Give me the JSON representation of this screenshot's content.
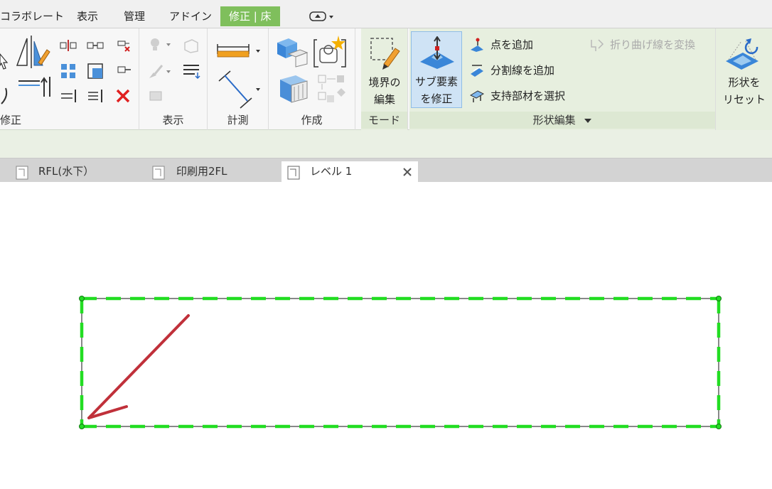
{
  "ribbon_tabs": [
    {
      "label": "コラボレート"
    },
    {
      "label": "表示"
    },
    {
      "label": "管理"
    },
    {
      "label": "アドイン"
    },
    {
      "label": "修正 | 床"
    }
  ],
  "panels": {
    "modify": {
      "label": "修正"
    },
    "view": {
      "label": "表示"
    },
    "measure": {
      "label": "計測"
    },
    "create": {
      "label": "作成"
    },
    "mode": {
      "label": "モード",
      "edit_boundary_label": "境界の\n編集"
    },
    "shape_edit": {
      "label": "形状編集",
      "modify_sub_elements_label": "サブ要素\nを修正",
      "add_point_label": "点を追加",
      "add_split_line_label": "分割線を追加",
      "pick_supports_label": "支持部材を選択",
      "draw_fold_line_label": "折り曲げ線を変換",
      "reset_shape_label": "形状を\nリセット"
    }
  },
  "view_tabs": [
    {
      "label": "RFL(水下）",
      "active": false
    },
    {
      "label": "印刷用2FL",
      "active": false
    },
    {
      "label": "レベル 1",
      "active": true
    }
  ],
  "colors": {
    "active_tab": "#7fbf5c",
    "boundary": "#22dd22",
    "arrow": "#c0303a"
  }
}
